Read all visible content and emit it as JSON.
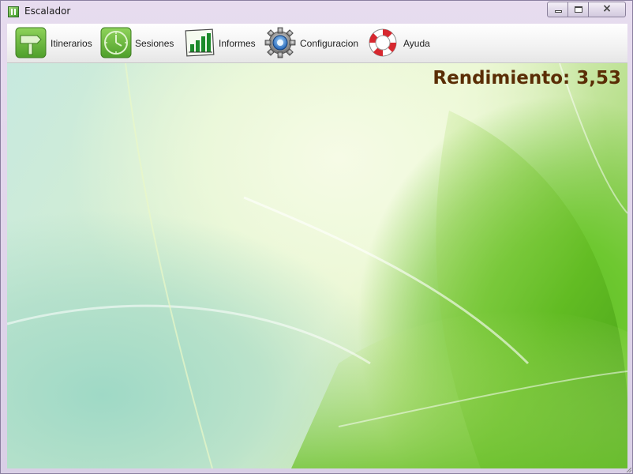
{
  "window": {
    "title": "Escalador",
    "icon": "app-icon"
  },
  "toolbar": {
    "items": [
      {
        "label": "Itinerarios",
        "icon": "signpost-icon"
      },
      {
        "label": "Sesiones",
        "icon": "clock-icon"
      },
      {
        "label": "Informes",
        "icon": "report-chart-icon"
      },
      {
        "label": "Configuracion",
        "icon": "gear-icon"
      },
      {
        "label": "Ayuda",
        "icon": "lifebuoy-icon"
      }
    ]
  },
  "main": {
    "rendimiento_text": "Rendimiento: 3,53"
  },
  "colors": {
    "rendimiento_text": "#5a2d05",
    "accent_green": "#6ec830",
    "window_frame": "#d9cfe6"
  }
}
